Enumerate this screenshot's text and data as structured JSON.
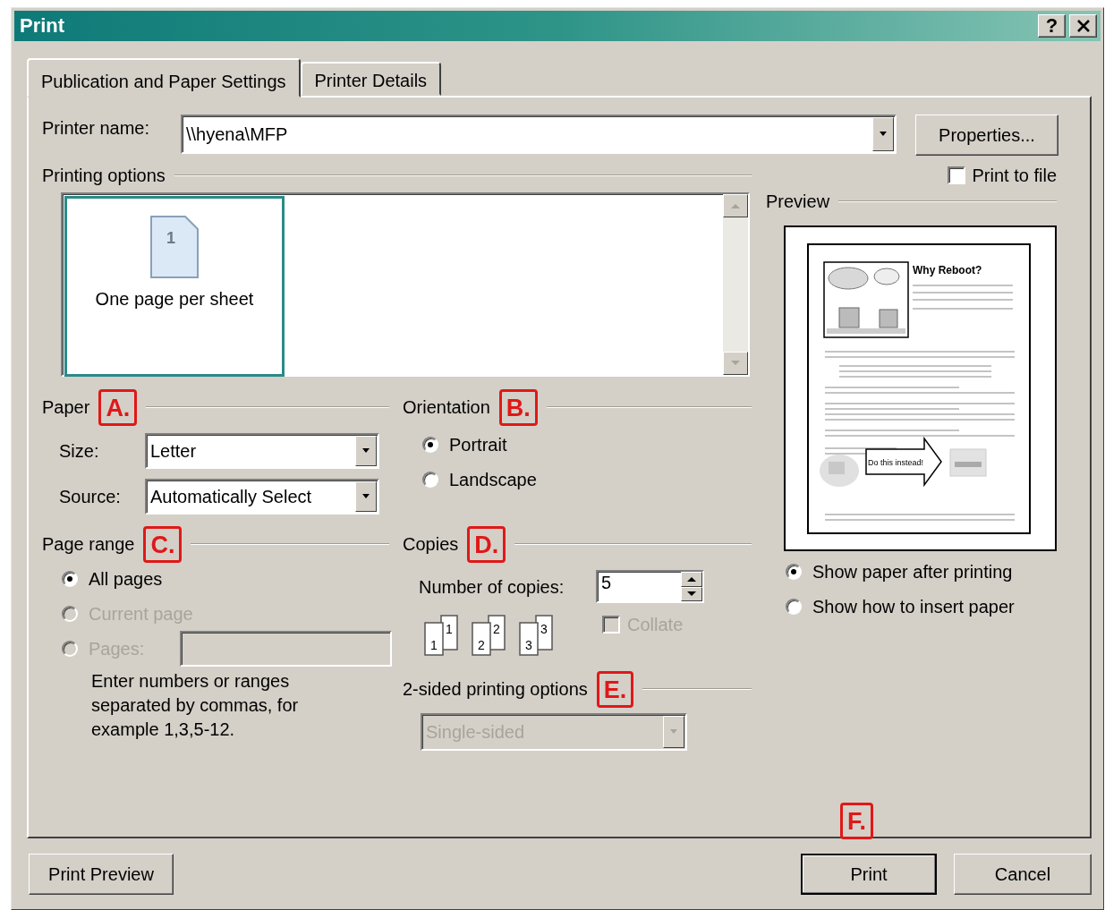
{
  "window": {
    "title": "Print",
    "help_label": "?"
  },
  "tabs": [
    {
      "label": "Publication and Paper Settings",
      "selected": true
    },
    {
      "label": "Printer Details",
      "selected": false
    }
  ],
  "printer": {
    "label": "Printer name:",
    "value": "\\\\hyena\\MFP",
    "properties_button": "Properties...",
    "print_to_file": {
      "label": "Print to file",
      "checked": false
    }
  },
  "printing_options": {
    "heading": "Printing options",
    "items": [
      {
        "label": "One page per sheet",
        "page_number": "1",
        "selected": true
      }
    ]
  },
  "paper": {
    "heading": "Paper",
    "callout": "A.",
    "size": {
      "label": "Size:",
      "value": "Letter"
    },
    "source": {
      "label": "Source:",
      "value": "Automatically Select"
    }
  },
  "orientation": {
    "heading": "Orientation",
    "callout": "B.",
    "options": [
      {
        "label": "Portrait",
        "selected": true
      },
      {
        "label": "Landscape",
        "selected": false
      }
    ]
  },
  "page_range": {
    "heading": "Page range",
    "callout": "C.",
    "options": [
      {
        "label": "All pages",
        "selected": true,
        "disabled": false,
        "kind": "plain"
      },
      {
        "label": "Current page",
        "selected": false,
        "disabled": true,
        "kind": "plain"
      },
      {
        "label": "Pages:",
        "selected": false,
        "disabled": true,
        "kind": "field"
      }
    ],
    "help": "Enter numbers or ranges separated by commas, for example 1,3,5-12."
  },
  "copies": {
    "heading": "Copies",
    "callout": "D.",
    "label": "Number of copies:",
    "value": "5",
    "collate_icon_numbers": [
      {
        "back": "1",
        "front": "1"
      },
      {
        "back": "2",
        "front": "2"
      },
      {
        "back": "3",
        "front": "3"
      }
    ],
    "collate": {
      "label": "Collate",
      "checked": false,
      "disabled": true
    }
  },
  "two_sided": {
    "heading": "2-sided printing options",
    "callout": "E.",
    "value": "Single-sided",
    "disabled": true
  },
  "preview": {
    "heading": "Preview",
    "page_heading": "Why Reboot?",
    "arrow_text": "Do this instead!",
    "options": [
      {
        "label": "Show paper after printing",
        "selected": true
      },
      {
        "label": "Show how to insert paper",
        "selected": false
      }
    ]
  },
  "footer": {
    "callout": "F.",
    "buttons": [
      {
        "label": "Print Preview",
        "kind": "normal"
      },
      {
        "label": "Print",
        "kind": "default"
      },
      {
        "label": "Cancel",
        "kind": "normal"
      }
    ]
  }
}
